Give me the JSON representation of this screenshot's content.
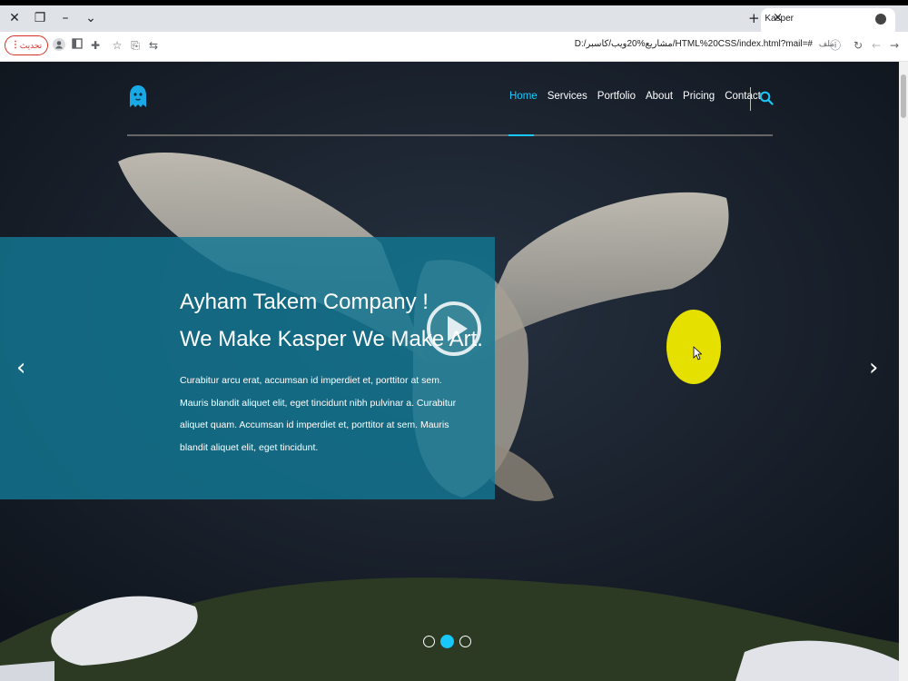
{
  "browser": {
    "tab_title": "Kasper",
    "url": "D:/مشاريع%20ويب/كاسبر/HTML%20CSS/index.html?mail=#",
    "site_label": "ملف",
    "update_button": "تحديث",
    "window_controls": [
      "close-icon",
      "restore-icon",
      "minimize-icon",
      "chevron-down-icon"
    ],
    "toolbar_icons": [
      "account-icon",
      "sidebar-icon",
      "extensions-icon",
      "star-icon",
      "share-icon",
      "translate-icon",
      "reload-icon",
      "back-icon",
      "forward-icon",
      "info-icon"
    ]
  },
  "nav": {
    "items": [
      "Home",
      "Services",
      "Portfolio",
      "About",
      "Pricing",
      "Contact"
    ],
    "active": "Home"
  },
  "hero": {
    "headline_line1": "Ayham Takem Company !",
    "headline_line2": "We Make Kasper We Make Art.",
    "paragraph": "Curabitur arcu erat, accumsan id imperdiet et, porttitor at sem. Mauris blandit aliquet elit, eget tincidunt nibh pulvinar a. Curabitur aliquet quam. Accumsan id imperdiet et, porttitor at sem. Mauris blandit aliquet elit, eget tincidunt.",
    "slider": {
      "count": 3,
      "active_index": 1
    },
    "prev_arrow": "‹",
    "next_arrow": "›"
  },
  "colors": {
    "accent": "#19c8fa",
    "overlay": "#127894",
    "cursor_highlight": "#e5e000",
    "browser_update": "#d93025"
  }
}
